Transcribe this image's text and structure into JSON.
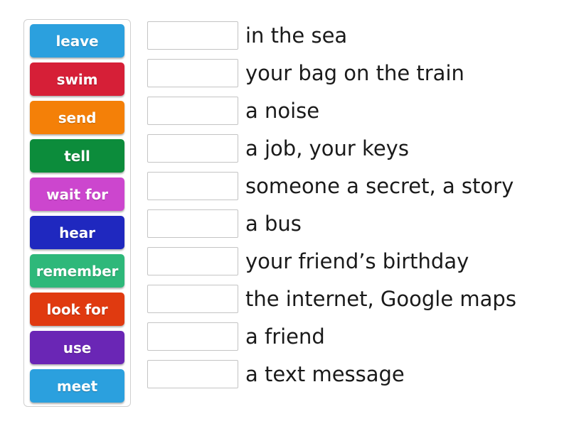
{
  "activity": {
    "type": "match-up-drag-and-drop",
    "tiles_panel_name": "word-tiles-panel"
  },
  "tiles": [
    {
      "label": "leave",
      "color": "#2ba0de"
    },
    {
      "label": "swim",
      "color": "#d61f37"
    },
    {
      "label": "send",
      "color": "#f48008"
    },
    {
      "label": "tell",
      "color": "#0c8c3b"
    },
    {
      "label": "wait for",
      "color": "#cc46ce"
    },
    {
      "label": "hear",
      "color": "#1f28bf"
    },
    {
      "label": "remember",
      "color": "#2eb87a"
    },
    {
      "label": "look for",
      "color": "#e03a10"
    },
    {
      "label": "use",
      "color": "#6a26b5"
    },
    {
      "label": "meet",
      "color": "#2ba0de"
    }
  ],
  "rows": [
    {
      "answer": "",
      "text": "in the sea"
    },
    {
      "answer": "",
      "text": "your bag on the train"
    },
    {
      "answer": "",
      "text": "a noise"
    },
    {
      "answer": "",
      "text": "a job, your keys"
    },
    {
      "answer": "",
      "text": "someone a secret, a story"
    },
    {
      "answer": "",
      "text": "a bus"
    },
    {
      "answer": "",
      "text": "your friend’s birthday"
    },
    {
      "answer": "",
      "text": "the internet, Google maps"
    },
    {
      "answer": "",
      "text": "a friend"
    },
    {
      "answer": "",
      "text": "a text message"
    }
  ]
}
